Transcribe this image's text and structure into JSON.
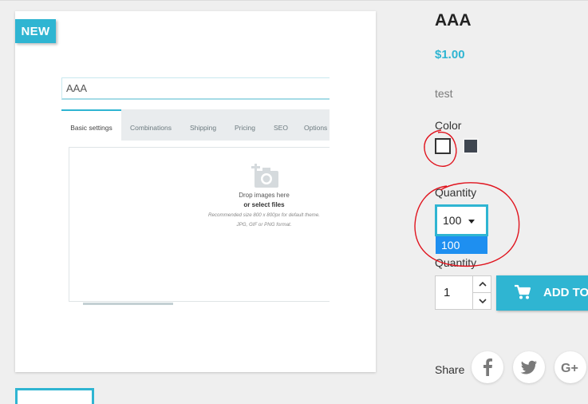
{
  "product": {
    "badge": "NEW",
    "name": "AAA",
    "price": "$1.00",
    "description": "test"
  },
  "preview": {
    "name_field_value": "AAA",
    "tabs": [
      {
        "label": "Basic settings",
        "active": true
      },
      {
        "label": "Combinations",
        "active": false
      },
      {
        "label": "Shipping",
        "active": false
      },
      {
        "label": "Pricing",
        "active": false
      },
      {
        "label": "SEO",
        "active": false
      },
      {
        "label": "Options",
        "active": false
      }
    ],
    "drop_line1": "Drop images here",
    "drop_line2": "or select files",
    "hint_line1": "Recommended size 800 x 800px for default theme.",
    "hint_line2": "JPG, GIF or PNG format.",
    "icon": "camera-add-icon"
  },
  "variants": {
    "color_label": "Color",
    "colors": [
      {
        "name": "white",
        "hex": "#ffffff",
        "selected": true
      },
      {
        "name": "dark-grey",
        "hex": "#3f4650",
        "selected": false
      }
    ],
    "quantity_select_label": "Quantity",
    "quantity_select_value": "100",
    "quantity_select_options": [
      "100"
    ],
    "quantity_select_highlighted": "100"
  },
  "cart": {
    "quantity_label": "Quantity",
    "quantity_value": "1",
    "add_label": "ADD TO CART",
    "icons": {
      "increase": "chevron-up-icon",
      "decrease": "chevron-down-icon",
      "cart": "cart-icon"
    }
  },
  "share": {
    "label": "Share",
    "networks": [
      "facebook-icon",
      "twitter-icon",
      "google-plus-icon"
    ]
  },
  "colors": {
    "accent": "#2fb5d2",
    "highlight": "#1e8ff0",
    "annotation": "#e0141e"
  }
}
